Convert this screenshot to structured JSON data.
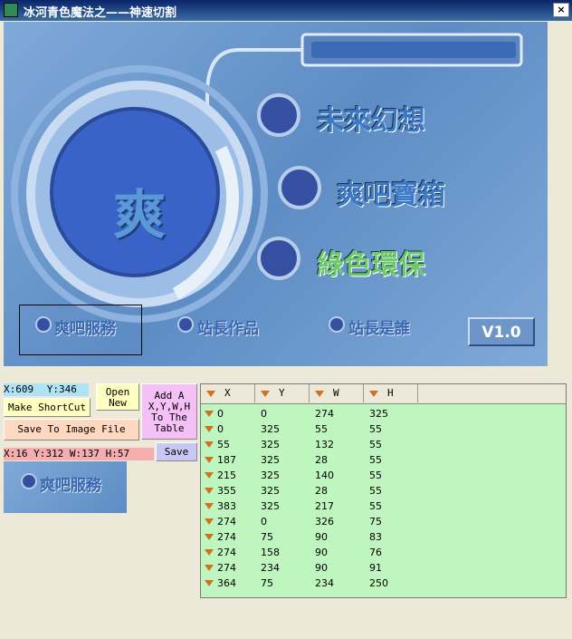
{
  "window": {
    "title": "冰河青色魔法之——神速切割",
    "close_glyph": "×"
  },
  "canvas": {
    "center_glyph": "爽",
    "menu": [
      {
        "label": "未來幻想",
        "color": "#3A78C8"
      },
      {
        "label": "爽吧寶箱",
        "color": "#3A78C8"
      },
      {
        "label": "綠色環保",
        "color": "#6BC86B"
      }
    ],
    "sub_menu": [
      {
        "label": "爽吧服務"
      },
      {
        "label": "站長作品"
      },
      {
        "label": "站長是誰"
      }
    ],
    "version": "V1.0"
  },
  "controls": {
    "coords": {
      "x_label": "X:609",
      "y_label": "Y:346"
    },
    "open_new": "Open New",
    "add_to_table": "Add A X,Y,W,H To The Table",
    "make_shortcut": "Make ShortCut",
    "save_to_image": "Save To Image File",
    "rect_readout": "X:16  Y:312  W:137 H:57",
    "save": "Save",
    "preview_label": "爽吧服務"
  },
  "table": {
    "columns": [
      "X",
      "Y",
      "W",
      "H"
    ],
    "rows": [
      [
        "0",
        "0",
        "274",
        "325"
      ],
      [
        "0",
        "325",
        "55",
        "55"
      ],
      [
        "55",
        "325",
        "132",
        "55"
      ],
      [
        "187",
        "325",
        "28",
        "55"
      ],
      [
        "215",
        "325",
        "140",
        "55"
      ],
      [
        "355",
        "325",
        "28",
        "55"
      ],
      [
        "383",
        "325",
        "217",
        "55"
      ],
      [
        "274",
        "0",
        "326",
        "75"
      ],
      [
        "274",
        "75",
        "90",
        "83"
      ],
      [
        "274",
        "158",
        "90",
        "76"
      ],
      [
        "274",
        "234",
        "90",
        "91"
      ],
      [
        "364",
        "75",
        "234",
        "250"
      ]
    ]
  },
  "colors": {
    "titlebar": "#0A246A",
    "canvas_bg": "#6F9BD0",
    "table_bg": "#BFF5BF",
    "coords_bg": "#ADE3F5",
    "rect_bg": "#F5ADAD",
    "open_new_bg": "#FFFFC0",
    "add_bg": "#F5C0F5",
    "shortcut_bg": "#FFFFC0",
    "save_image_bg": "#FFD8C0",
    "save_bg": "#C8C8F5"
  }
}
